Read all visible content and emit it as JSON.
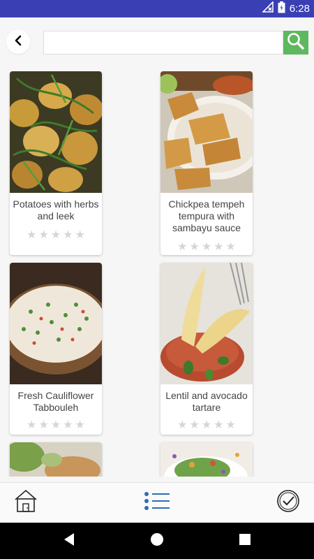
{
  "status_bar": {
    "time": "6:28"
  },
  "search": {
    "placeholder": "",
    "value": ""
  },
  "recipes": [
    {
      "title": "Potatoes with herbs and leek",
      "stars": 0,
      "max_stars": 5
    },
    {
      "title": "Chickpea tempeh tempura with sambayu sauce",
      "stars": 0,
      "max_stars": 5
    },
    {
      "title": "Fresh Cauliflower Tabbouleh",
      "stars": 0,
      "max_stars": 5
    },
    {
      "title": "Lentil and avocado tartare",
      "stars": 0,
      "max_stars": 5
    },
    {
      "title": "",
      "stars": 0,
      "max_stars": 5
    },
    {
      "title": "",
      "stars": 0,
      "max_stars": 5
    }
  ],
  "icons": {
    "back": "back-arrow-icon",
    "search": "search-icon",
    "home": "home-icon",
    "list": "list-icon",
    "check": "check-circle-icon"
  },
  "colors": {
    "status_bar": "#3a3fb4",
    "search_button": "#5fb85f",
    "star_empty": "#d6d6d6",
    "nav_icon_blue": "#2f6db5"
  }
}
